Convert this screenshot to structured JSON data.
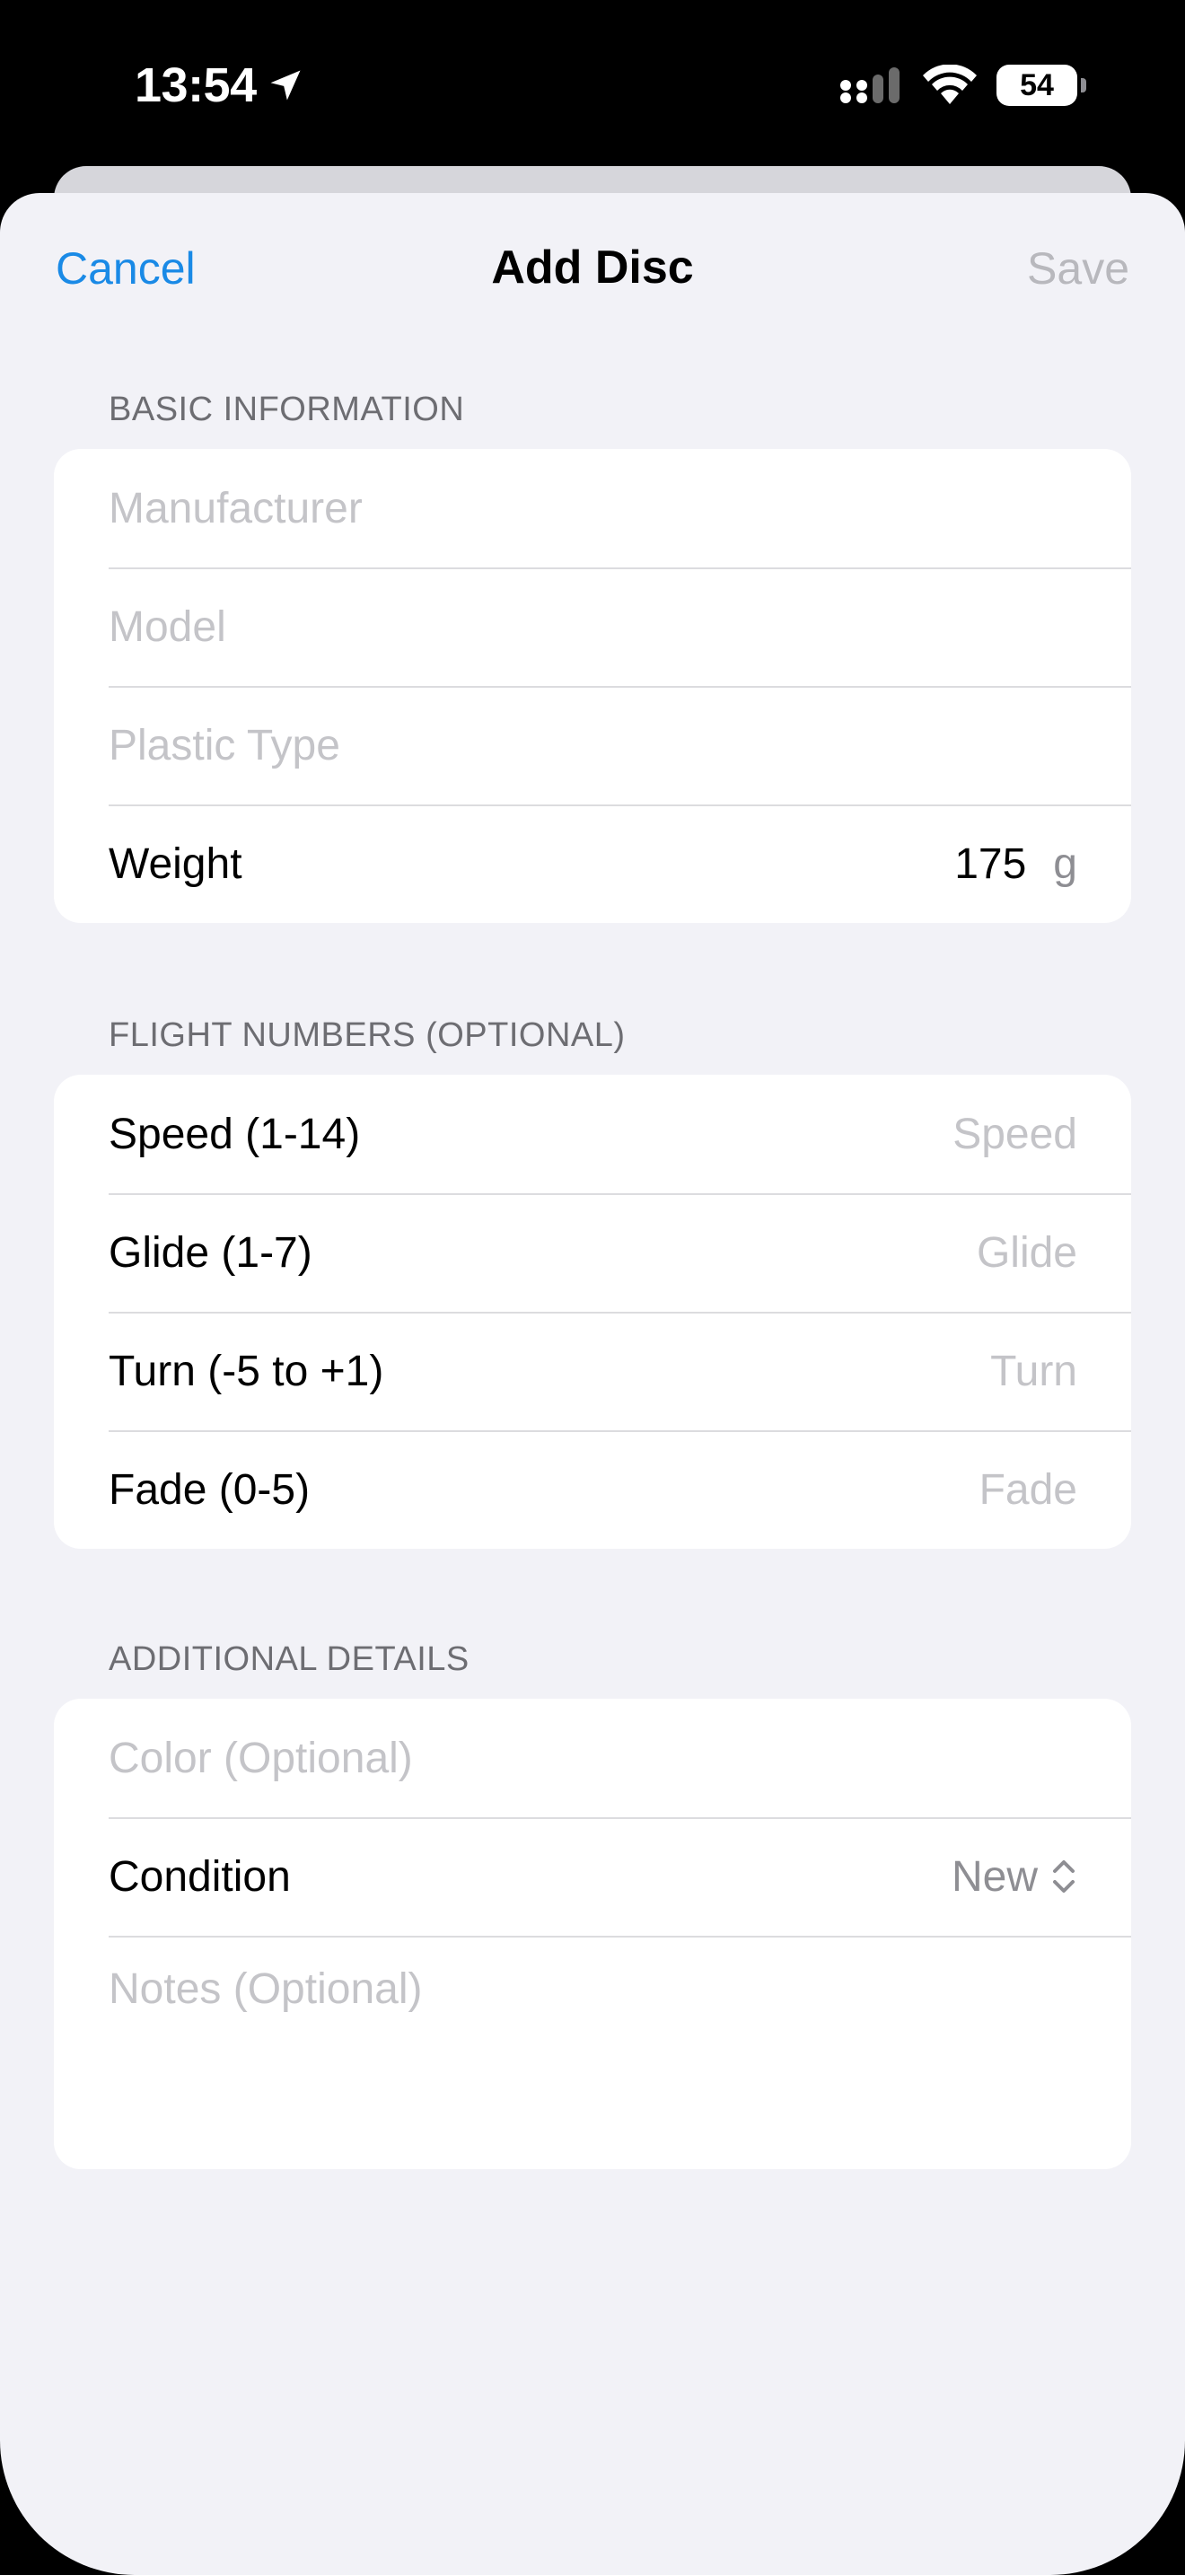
{
  "status_bar": {
    "time": "13:54",
    "battery": "54",
    "icons": [
      "location-arrow-icon",
      "cellular-signal-icon",
      "wifi-icon",
      "battery-icon"
    ]
  },
  "nav": {
    "cancel_label": "Cancel",
    "title": "Add Disc",
    "save_label": "Save"
  },
  "basic": {
    "header": "BASIC INFORMATION",
    "manufacturer_placeholder": "Manufacturer",
    "model_placeholder": "Model",
    "plastic_placeholder": "Plastic Type",
    "weight_label": "Weight",
    "weight_value": "175",
    "weight_unit": "g"
  },
  "flight": {
    "header": "FLIGHT NUMBERS (OPTIONAL)",
    "speed_label": "Speed (1-14)",
    "speed_placeholder": "Speed",
    "glide_label": "Glide (1-7)",
    "glide_placeholder": "Glide",
    "turn_label": "Turn (-5 to +1)",
    "turn_placeholder": "Turn",
    "fade_label": "Fade (0-5)",
    "fade_placeholder": "Fade"
  },
  "details": {
    "header": "ADDITIONAL DETAILS",
    "color_placeholder": "Color (Optional)",
    "condition_label": "Condition",
    "condition_value": "New",
    "notes_placeholder": "Notes (Optional)"
  },
  "colors": {
    "accent": "#1a8ae6",
    "background": "#f2f2f7",
    "placeholder": "#c4c4c8"
  }
}
